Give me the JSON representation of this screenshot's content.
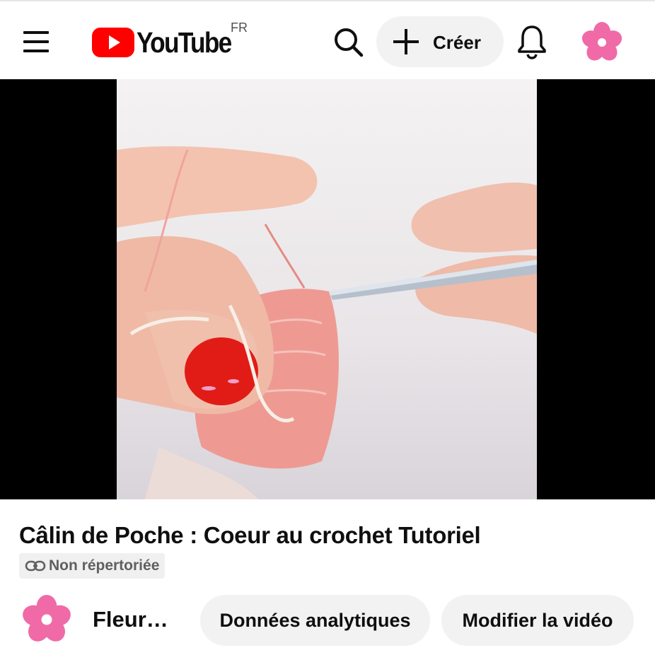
{
  "header": {
    "logo_text": "YouTube",
    "region_code": "FR",
    "create_label": "Créer",
    "brand_red": "#ff0000"
  },
  "icons": {
    "menu": "hamburger-menu-icon",
    "search": "search-icon",
    "create": "plus-icon",
    "notifications": "bell-icon",
    "avatar": "pink-flower-avatar",
    "visibility": "link-icon"
  },
  "video": {
    "title": "Câlin de Poche : Coeur au crochet Tutoriel",
    "visibility_label": "Non répertoriée"
  },
  "channel": {
    "name": "Fleur…"
  },
  "actions": {
    "analytics_label": "Données analytiques",
    "edit_label": "Modifier la vidéo"
  },
  "colors": {
    "avatar_pink": "#f06aa8",
    "pill_bg": "#f2f2f2",
    "badge_bg": "#f0f0f0"
  }
}
